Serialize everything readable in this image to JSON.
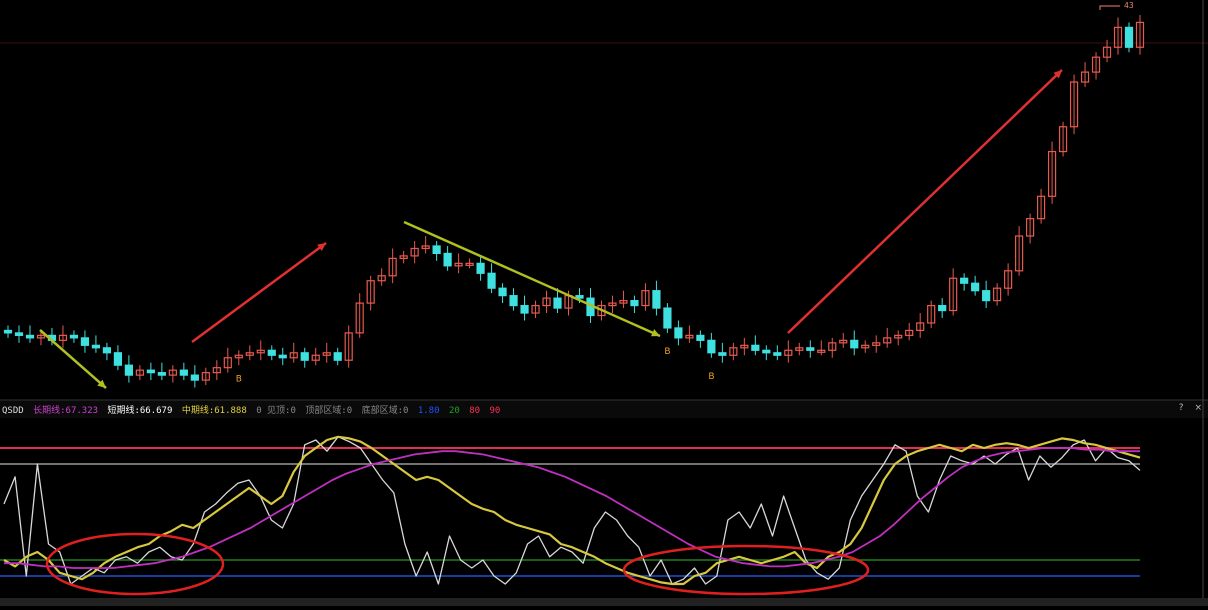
{
  "indicator": {
    "name": "QSDD",
    "lines": [
      {
        "label": "长期线:67.323",
        "color": "#d040d0"
      },
      {
        "label": "短期线:66.679",
        "color": "#ffffff"
      },
      {
        "label": "中期线:61.888",
        "color": "#e0d040"
      },
      {
        "label": "0 见顶:0",
        "color": "#888888"
      },
      {
        "label": "顶部区域:0",
        "color": "#888888"
      },
      {
        "label": "底部区域:0",
        "color": "#888888"
      },
      {
        "label": "1.80",
        "color": "#2050ff"
      },
      {
        "label": "20",
        "color": "#20a020"
      },
      {
        "label": "80",
        "color": "#ff3050"
      },
      {
        "label": "90",
        "color": "#ff3050"
      }
    ],
    "window_controls": [
      "?",
      "×"
    ]
  },
  "price_high_label": "43",
  "colors": {
    "up": "#e85a4f",
    "down": "#3fe0e0",
    "ma_long": "#c030c0",
    "ma_mid": "#d8c840",
    "ma_short": "#d8d8d8",
    "arrow_red": "#e03030",
    "arrow_yellow": "#b0c020",
    "level_90": "#e03050",
    "level_80": "#999999",
    "level_20": "#208020",
    "level_bottom": "#2050d0",
    "ellipse": "#e02020"
  },
  "chart_data": [
    {
      "type": "candlestick",
      "title": "",
      "candles_close": [
        65,
        64,
        63,
        64,
        62,
        64,
        63,
        60,
        59,
        57,
        52,
        48,
        50,
        49,
        48,
        50,
        48,
        46,
        49,
        51,
        55,
        56,
        57,
        58,
        56,
        55,
        57,
        54,
        56,
        57,
        54,
        65,
        77,
        86,
        88,
        95,
        96,
        99,
        100,
        97,
        92,
        93,
        93,
        89,
        83,
        80,
        76,
        73,
        76,
        79,
        75,
        80,
        79,
        72,
        76,
        77,
        78,
        76,
        82,
        75,
        67,
        63,
        64,
        62,
        57,
        56,
        59,
        60,
        58,
        57,
        56,
        58,
        59,
        58,
        58,
        61,
        62,
        59,
        60,
        61,
        63,
        64,
        66,
        69,
        76,
        74,
        87,
        85,
        82,
        78,
        83,
        90,
        104,
        111,
        120,
        138,
        148,
        166,
        170,
        176,
        180,
        188,
        180,
        190
      ],
      "markers": [
        {
          "index": 21,
          "label": "B"
        },
        {
          "index": 60,
          "label": "B"
        },
        {
          "index": 64,
          "label": "B"
        }
      ],
      "annotations": [
        "43"
      ]
    },
    {
      "type": "line",
      "title": "QSDD",
      "ylim": [
        0,
        100
      ],
      "levels": [
        90,
        80,
        20,
        10
      ],
      "series": [
        {
          "name": "短期线",
          "values": [
            55,
            72,
            10,
            80,
            30,
            25,
            5,
            10,
            15,
            12,
            20,
            22,
            18,
            25,
            28,
            22,
            20,
            30,
            50,
            55,
            62,
            68,
            70,
            60,
            45,
            40,
            55,
            92,
            95,
            88,
            97,
            94,
            90,
            80,
            70,
            62,
            30,
            10,
            25,
            5,
            35,
            20,
            15,
            20,
            10,
            5,
            12,
            30,
            35,
            22,
            28,
            25,
            18,
            40,
            50,
            45,
            35,
            28,
            10,
            20,
            5,
            8,
            15,
            5,
            10,
            45,
            50,
            40,
            55,
            35,
            60,
            40,
            20,
            12,
            8,
            15,
            45,
            60,
            70,
            80,
            92,
            88,
            60,
            50,
            70,
            85,
            82,
            80,
            85,
            80,
            86,
            90,
            70,
            85,
            78,
            84,
            92,
            95,
            82,
            90,
            84,
            82,
            76
          ]
        },
        {
          "name": "中期线",
          "values": [
            20,
            16,
            22,
            25,
            20,
            12,
            10,
            8,
            12,
            18,
            22,
            25,
            28,
            30,
            35,
            38,
            42,
            40,
            45,
            50,
            55,
            60,
            65,
            60,
            55,
            60,
            75,
            85,
            90,
            95,
            97,
            96,
            94,
            90,
            85,
            80,
            75,
            70,
            72,
            70,
            65,
            60,
            55,
            52,
            50,
            45,
            42,
            40,
            38,
            36,
            30,
            28,
            25,
            22,
            18,
            15,
            12,
            10,
            8,
            6,
            5,
            5,
            10,
            12,
            18,
            20,
            22,
            20,
            18,
            20,
            22,
            25,
            18,
            15,
            22,
            25,
            30,
            40,
            55,
            70,
            80,
            85,
            88,
            90,
            92,
            90,
            88,
            92,
            90,
            92,
            93,
            92,
            90,
            92,
            94,
            96,
            95,
            93,
            92,
            90,
            88,
            86,
            84
          ]
        },
        {
          "name": "长期线",
          "values": [
            18,
            18,
            17,
            16,
            16,
            15,
            15,
            15,
            15,
            16,
            17,
            18,
            20,
            22,
            25,
            28,
            32,
            36,
            40,
            45,
            50,
            55,
            60,
            65,
            70,
            74,
            77,
            80,
            82,
            84,
            86,
            87,
            88,
            88,
            87,
            86,
            84,
            82,
            80,
            78,
            75,
            72,
            68,
            64,
            60,
            55,
            50,
            45,
            40,
            35,
            30,
            26,
            22,
            20,
            18,
            17,
            16,
            16,
            17,
            18,
            20,
            22,
            25,
            30,
            35,
            42,
            50,
            58,
            65,
            72,
            78,
            82,
            85,
            87,
            88,
            89,
            90,
            90,
            90,
            89,
            89,
            88,
            88,
            88
          ]
        }
      ]
    }
  ]
}
